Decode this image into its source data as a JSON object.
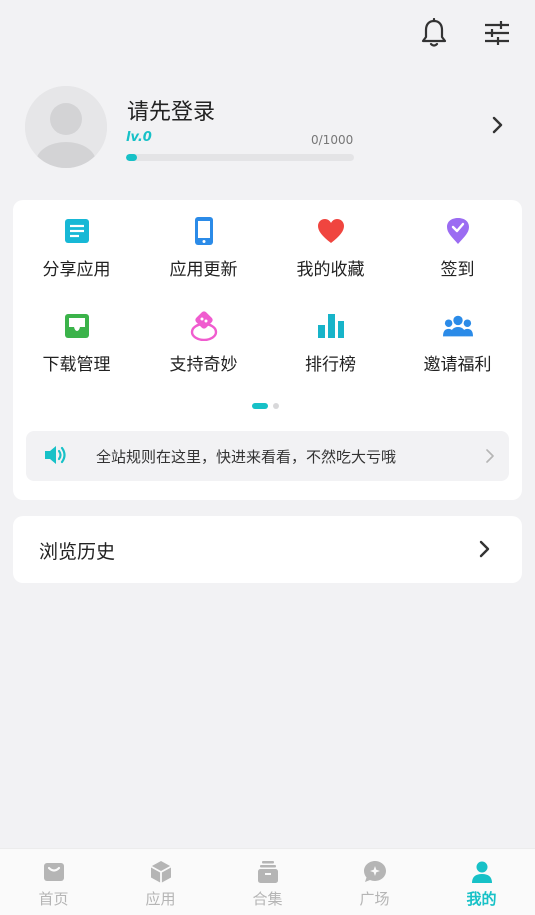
{
  "profile": {
    "login_text": "请先登录",
    "level": "lv.0",
    "exp": "0/1000",
    "progress_fraction": 0.05
  },
  "grid": {
    "items": [
      {
        "label": "分享应用",
        "icon": "share-doc-icon",
        "color": "#17b8d6"
      },
      {
        "label": "应用更新",
        "icon": "phone-update-icon",
        "color": "#2b8be8"
      },
      {
        "label": "我的收藏",
        "icon": "heart-icon",
        "color": "#f0453f"
      },
      {
        "label": "签到",
        "icon": "checkin-badge-icon",
        "color": "#9b6cf2"
      },
      {
        "label": "下载管理",
        "icon": "download-tray-icon",
        "color": "#3bb34a"
      },
      {
        "label": "支持奇妙",
        "icon": "support-gift-icon",
        "color": "#f05ccf"
      },
      {
        "label": "排行榜",
        "icon": "bar-chart-icon",
        "color": "#17b4c9"
      },
      {
        "label": "邀请福利",
        "icon": "invite-group-icon",
        "color": "#2b8be8"
      }
    ]
  },
  "notice": {
    "text": "全站规则在这里，快进来看看，不然吃大亏哦",
    "icon": "speaker-icon",
    "color": "#17c1c7"
  },
  "history": {
    "label": "浏览历史"
  },
  "tabbar": {
    "tabs": [
      {
        "label": "首页",
        "icon": "home-icon"
      },
      {
        "label": "应用",
        "icon": "cube-icon"
      },
      {
        "label": "合集",
        "icon": "collection-icon"
      },
      {
        "label": "广场",
        "icon": "chat-bubble-icon"
      },
      {
        "label": "我的",
        "icon": "person-icon",
        "active": true
      }
    ],
    "accent": "#17c1c7",
    "inactive": "#b5b5b5"
  }
}
